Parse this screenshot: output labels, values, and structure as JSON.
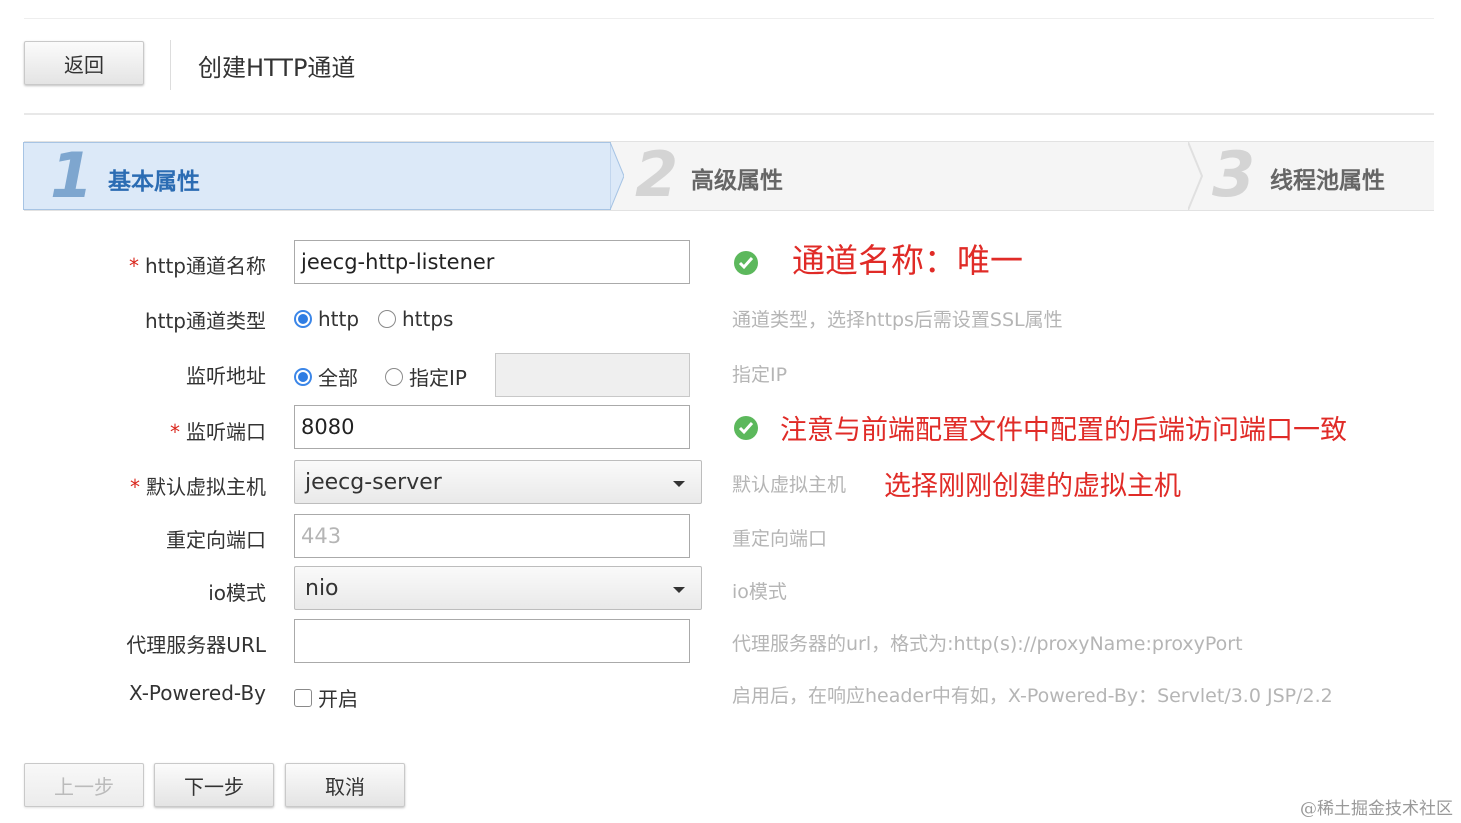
{
  "header": {
    "back_label": "返回",
    "title": "创建HTTP通道"
  },
  "wizard": {
    "steps": [
      {
        "number": "1",
        "label": "基本属性",
        "active": true
      },
      {
        "number": "2",
        "label": "高级属性",
        "active": false
      },
      {
        "number": "3",
        "label": "线程池属性",
        "active": false
      }
    ]
  },
  "form": {
    "name": {
      "label": "http通道名称",
      "required": "*",
      "value": "jeecg-http-listener",
      "note": "通道名称：唯一"
    },
    "type": {
      "label": "http通道类型",
      "options": [
        "http",
        "https"
      ],
      "selected": "http",
      "hint": "通道类型，选择https后需设置SSL属性"
    },
    "listen": {
      "label": "监听地址",
      "options": [
        "全部",
        "指定IP"
      ],
      "selected": "全部",
      "ip_value": "",
      "hint": "指定IP"
    },
    "port": {
      "label": "监听端口",
      "required": "*",
      "value": "8080",
      "note": "注意与前端配置文件中配置的后端访问端口一致"
    },
    "vhost": {
      "label": "默认虚拟主机",
      "required": "*",
      "value": "jeecg-server",
      "hint": "默认虚拟主机",
      "note": "选择刚刚创建的虚拟主机"
    },
    "redirect": {
      "label": "重定向端口",
      "value": "443",
      "hint": "重定向端口"
    },
    "io": {
      "label": "io模式",
      "value": "nio",
      "hint": "io模式"
    },
    "proxy": {
      "label": "代理服务器URL",
      "value": "",
      "hint": "代理服务器的url，格式为:http(s)://proxyName:proxyPort"
    },
    "powered": {
      "label": "X-Powered-By",
      "checkbox_label": "开启",
      "checked": false,
      "hint": "启用后，在响应header中有如，X-Powered-By：Servlet/3.0 JSP/2.2"
    }
  },
  "footer": {
    "prev_label": "上一步",
    "next_label": "下一步",
    "cancel_label": "取消"
  },
  "watermark": "@稀土掘金技术社区",
  "colors": {
    "accent": "#2b6cb3",
    "note_red": "#e02b27",
    "ok_green": "#5cb85c"
  }
}
